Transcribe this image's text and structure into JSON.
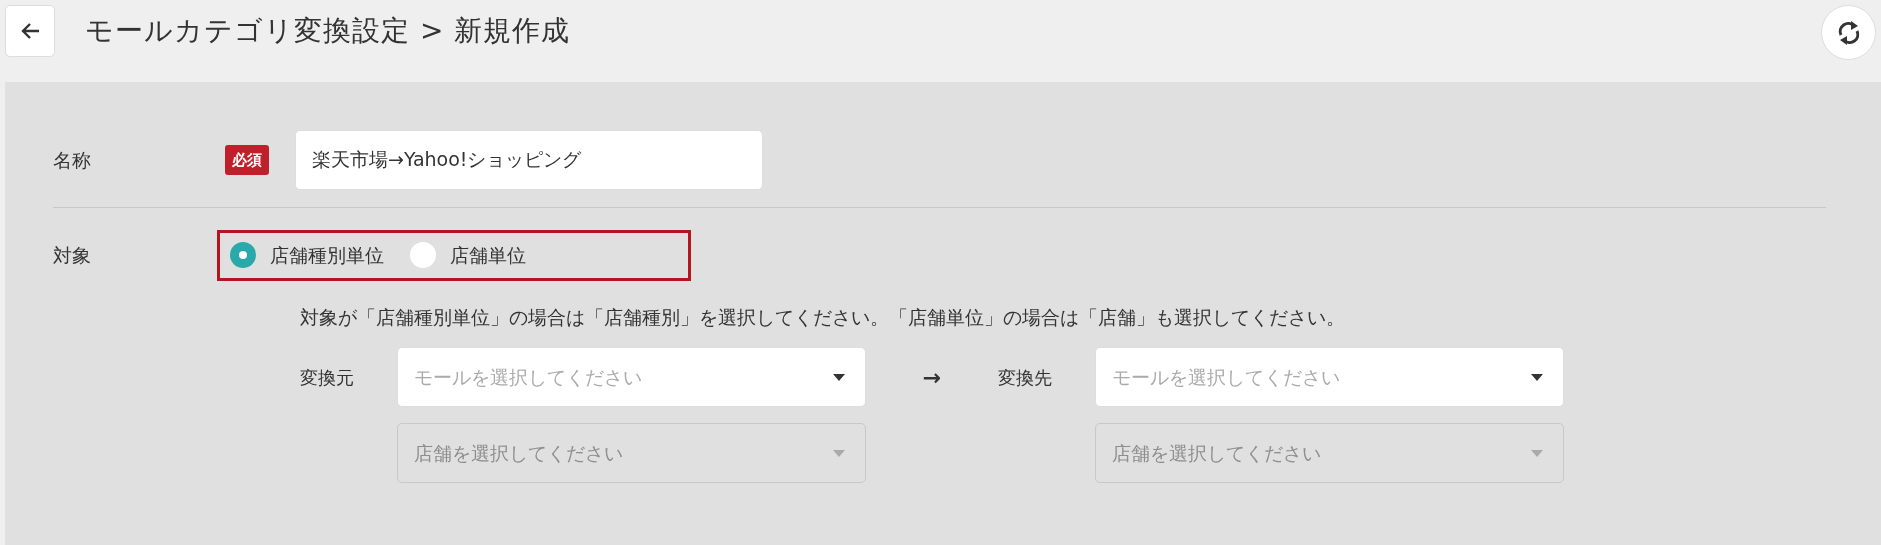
{
  "header": {
    "title": "モールカテゴリ変換設定 > 新規作成"
  },
  "form": {
    "name": {
      "label": "名称",
      "badge": "必須",
      "value": "楽天市場→Yahoo!ショッピング"
    },
    "target": {
      "label": "対象",
      "highlighted": true,
      "options": [
        {
          "label": "店舗種別単位",
          "selected": true
        },
        {
          "label": "店舗単位",
          "selected": false
        }
      ]
    },
    "note": "対象が「店舗種別単位」の場合は「店舗種別」を選択してください。「店舗単位」の場合は「店舗」も選択してください。",
    "mapping": {
      "arrow": "→",
      "sides": [
        {
          "label": "変換元",
          "selects": [
            {
              "placeholder": "モールを選択してください",
              "disabled": false
            },
            {
              "placeholder": "店舗を選択してください",
              "disabled": true
            }
          ]
        },
        {
          "label": "変換先",
          "selects": [
            {
              "placeholder": "モールを選択してください",
              "disabled": false
            },
            {
              "placeholder": "店舗を選択してください",
              "disabled": true
            }
          ]
        }
      ]
    }
  }
}
